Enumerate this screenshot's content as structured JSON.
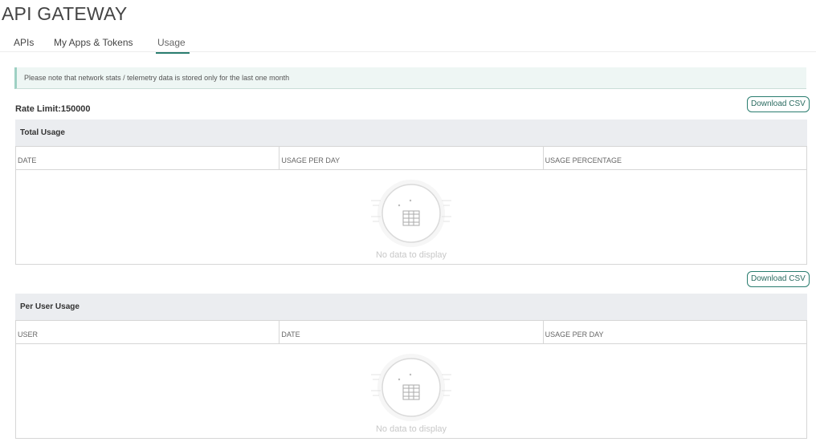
{
  "page": {
    "title": "API GATEWAY"
  },
  "tabs": [
    {
      "label": "APIs"
    },
    {
      "label": "My Apps & Tokens"
    },
    {
      "label": "Usage"
    }
  ],
  "notice": {
    "text": "Please note that network stats / telemetry data is stored only for the last one month"
  },
  "rate_limit": {
    "text": "Rate Limit:150000"
  },
  "total_usage": {
    "download_label": "Download CSV",
    "title": "Total Usage",
    "columns": [
      "DATE",
      "USAGE PER DAY",
      "USAGE PERCENTAGE"
    ],
    "empty_text": "No data to display"
  },
  "per_user_usage": {
    "download_label": "Download CSV",
    "title": "Per User Usage",
    "columns": [
      "USER",
      "DATE",
      "USAGE PER DAY"
    ],
    "empty_text": "No data to display"
  },
  "colors": {
    "accent": "#2a7d6f",
    "notice_bg": "#eef6f4",
    "panel_head_bg": "#ebedf0"
  }
}
